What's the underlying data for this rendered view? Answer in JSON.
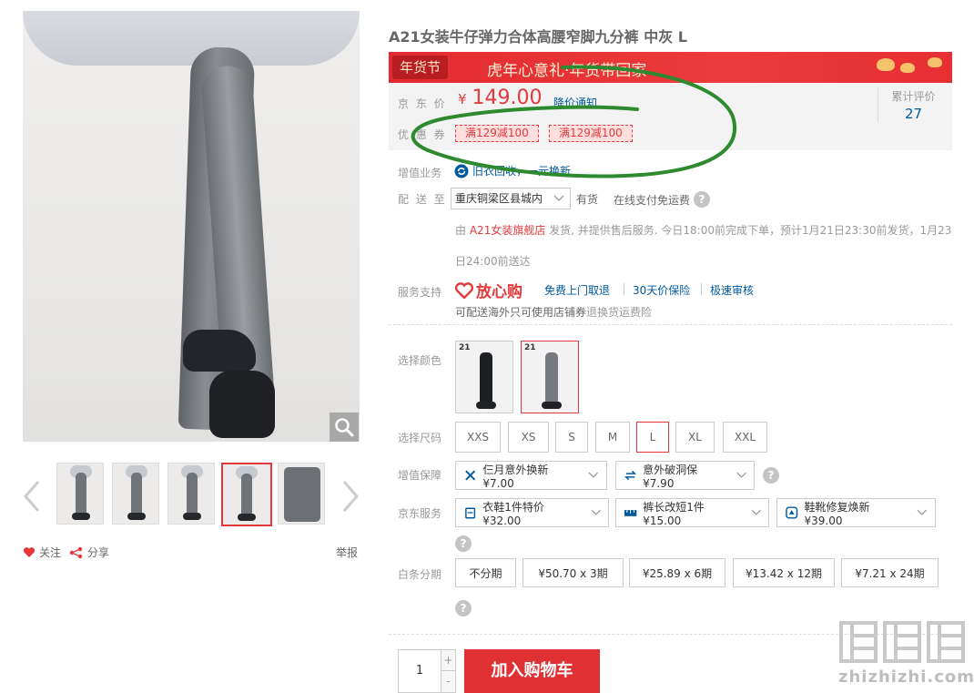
{
  "product": {
    "title": "A21女装牛仔弹力合体高腰窄脚九分裤 中灰 L"
  },
  "gallery": {
    "follow_label": "关注",
    "share_label": "分享",
    "report_label": "举报",
    "thumb_count": 5,
    "active_thumb": 4
  },
  "promo": {
    "logo_text": "年货节",
    "banner_text": "虎年心意礼·年货带回家"
  },
  "price": {
    "label": "京 东 价",
    "currency": "¥",
    "value": "149.00",
    "notify_label": "降价通知",
    "rating_label": "累计评价",
    "rating_count": "27"
  },
  "coupons": {
    "label": "优 惠 券",
    "items": [
      "满129减100",
      "满129减100"
    ]
  },
  "services": {
    "value_added_label": "增值业务",
    "recycle_text": "旧衣回收，一元换新",
    "delivery_label": "配 送 至",
    "address": "重庆铜梁区县城内",
    "stock": "有货",
    "pay": "在线支付免运费",
    "ship_prefix": "由",
    "shop_name": "A21女装旗舰店",
    "ship_text": "发货, 并提供售后服务. 今日18:00前完成下单，预计1月21日23:30前发货，1月23日24:00前送达",
    "support_label": "服务支持",
    "assure_text": "放心购",
    "support_links": [
      "免费上门取退",
      "30天价保险",
      "极速审核"
    ],
    "overseas_text": "可配送海外只可使用店铺券",
    "overseas_note": "退换货运费险"
  },
  "options": {
    "color_label": "选择颜色",
    "size_label": "选择尺码",
    "sizes": [
      "XXS",
      "XS",
      "S",
      "M",
      "L",
      "XL",
      "XXL"
    ],
    "selected_size": "L",
    "guarantee_label": "增值保障",
    "guarantees": [
      "仨月意外换新 ¥7.00",
      "意外破洞保 ¥7.90"
    ],
    "jd_service_label": "京东服务",
    "jd_services": [
      "衣鞋1件特价 ¥32.00",
      "裤长改短1件 ¥15.00",
      "鞋靴修复焕新 ¥39.00"
    ],
    "installment_label": "白条分期",
    "installments": [
      "不分期",
      "¥50.70 x 3期",
      "¥25.89 x 6期",
      "¥13.42 x 12期",
      "¥7.21 x 24期"
    ]
  },
  "cart": {
    "quantity": "1",
    "plus": "+",
    "minus": "-",
    "add_label": "加入购物车"
  },
  "watermark": {
    "logo_text": "值值值",
    "site": "zhizhizhi.com"
  },
  "colors": {
    "accent": "#e4393c",
    "link": "#005aa0",
    "annotation": "#2e8a2e"
  }
}
